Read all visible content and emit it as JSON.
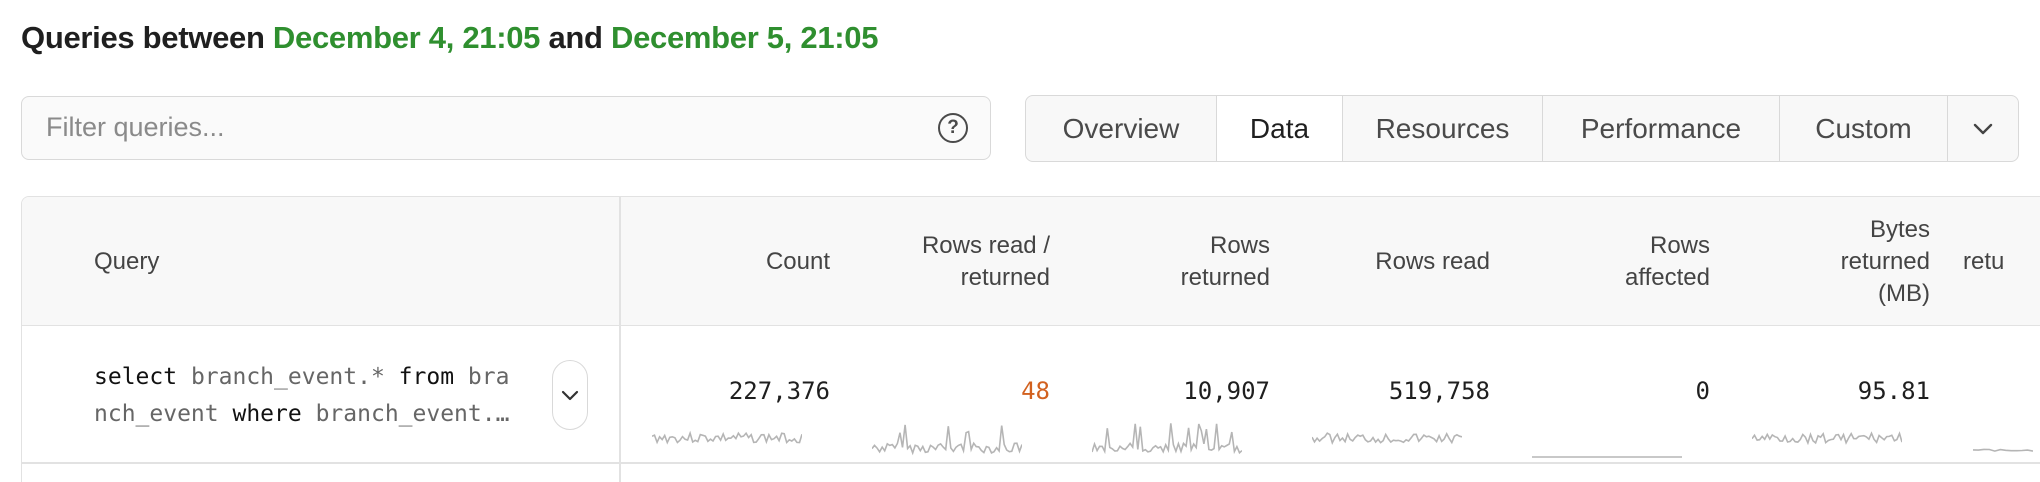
{
  "header": {
    "prefix": "Queries between",
    "start": "December 4, 21:05",
    "middle": "and",
    "end": "December 5, 21:05"
  },
  "filter": {
    "placeholder": "Filter queries...",
    "value": "",
    "help_icon": "question-circle-icon",
    "help_glyph": "?"
  },
  "tabs": [
    {
      "label": "Overview",
      "active": false
    },
    {
      "label": "Data",
      "active": true
    },
    {
      "label": "Resources",
      "active": false
    },
    {
      "label": "Performance",
      "active": false
    },
    {
      "label": "Custom",
      "active": false
    }
  ],
  "tabs_menu_icon": "chevron-down-icon",
  "table": {
    "columns": {
      "query": "Query",
      "count": "Count",
      "rows_read_returned_1": "Rows read /",
      "rows_read_returned_2": "returned",
      "rows_returned_1": "Rows",
      "rows_returned_2": "returned",
      "rows_read": "Rows read",
      "rows_affected_1": "Rows",
      "rows_affected_2": "affected",
      "bytes_returned_1": "Bytes",
      "bytes_returned_2": "returned",
      "bytes_returned_3": "(MB)",
      "next_partial": "retu"
    },
    "row": {
      "sql_tokens": {
        "t1": "select",
        "t2": " branch_event.* ",
        "t3": "from",
        "t4": " bra",
        "t5": "nch_event ",
        "t6": "where",
        "t7": " branch_event.…"
      },
      "expand_icon": "chevron-down-icon",
      "count": "227,376",
      "rows_read_returned": "48",
      "rows_returned": "10,907",
      "rows_read": "519,758",
      "rows_affected": "0",
      "bytes_returned_mb": "95.81"
    }
  },
  "colors": {
    "date_green": "#2f8f2f",
    "warn_orange": "#d2611f",
    "sparkline": "#b5b5b5",
    "border": "#d9d9d9"
  }
}
